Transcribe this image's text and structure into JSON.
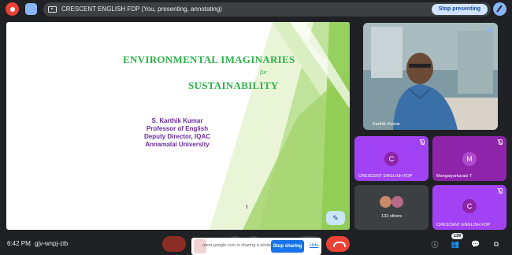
{
  "topbar": {
    "presenting_title": "CRESCENT ENGLISH FDP (You, presenting, annotating)",
    "stop_presenting_label": "Stop presenting",
    "icons": [
      "record-icon",
      "edit-icon",
      "present-icon",
      "annotate-icon"
    ]
  },
  "slide": {
    "title_line1": "ENVIRONMENTAL IMAGINARIES",
    "title_for": "for",
    "title_line2": "SUSTAINABILITY",
    "author_lines": [
      "S. Karthik Kumar",
      "Professor of English",
      "Deputy Director, IQAC",
      "Annamalai University"
    ],
    "title_color": "#2db34a",
    "author_color": "#6a2aa0"
  },
  "participants": {
    "speaker_name": "Karthik Kumar",
    "tiles": [
      {
        "name": "CRESCENT ENGLISH FDP",
        "initial": "C",
        "color": "#a142f4"
      },
      {
        "name": "Mangaiyarkarasi T",
        "initial": "M",
        "color": "#8e24aa"
      },
      {
        "name": "133 others",
        "initial": "",
        "color": "#3c4043"
      },
      {
        "name": "CRESCENT ENGLISH FDP",
        "initial": "C",
        "color": "#a142f4"
      }
    ]
  },
  "bottombar": {
    "time": "6:42 PM",
    "separator": "|",
    "meeting_code": "gjv-wnpj-zib",
    "share_notice": "meet.google.com is sharing a window.",
    "stop_sharing_label": "Stop sharing",
    "hide_label": "Hide",
    "participant_count": "139"
  }
}
